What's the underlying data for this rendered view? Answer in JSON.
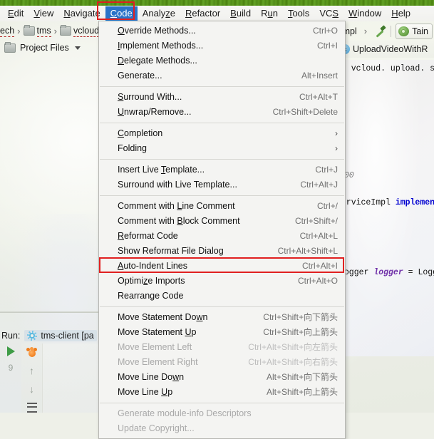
{
  "topbar": {
    "strip_color": "#4f8a18"
  },
  "menubar": {
    "items": [
      {
        "label": "Edit",
        "mnemonic": "E",
        "active": false
      },
      {
        "label": "View",
        "mnemonic": "V",
        "active": false
      },
      {
        "label": "Navigate",
        "mnemonic": "N",
        "active": false
      },
      {
        "label": "Code",
        "mnemonic": "C",
        "active": true
      },
      {
        "label": "Analyze",
        "mnemonic": "z",
        "active": false
      },
      {
        "label": "Refactor",
        "mnemonic": "R",
        "active": false
      },
      {
        "label": "Build",
        "mnemonic": "B",
        "active": false
      },
      {
        "label": "Run",
        "mnemonic": "u",
        "active": false
      },
      {
        "label": "Tools",
        "mnemonic": "T",
        "active": false
      },
      {
        "label": "VCS",
        "mnemonic": "S",
        "active": false
      },
      {
        "label": "Window",
        "mnemonic": "W",
        "active": false
      },
      {
        "label": "Help",
        "mnemonic": "H",
        "active": false
      }
    ]
  },
  "navbar": {
    "crumbs": [
      "ech",
      "tms",
      "vcloud",
      "ceImpl"
    ],
    "run_config": "Tain",
    "project_files_label": "Project Files"
  },
  "classbar": {
    "icon_letter": "c",
    "class_name": "UploadVideoWithR"
  },
  "editor_fragments": {
    "package_line": "s. vcloud. upload. servic",
    "time_line": ":00",
    "class_line_prefix": "ServiceImpl ",
    "class_line_keyword": "implement",
    "logger_prefix": "Logger ",
    "logger_field": "logger",
    "logger_suffix": " = Logge"
  },
  "run_toolwindow": {
    "label": "Run:",
    "tab_name": "tms-client [pa",
    "gutter_number": "9"
  },
  "code_menu": {
    "highlight_color": "#e02020",
    "groups": [
      {
        "items": [
          {
            "label": "Override Methods...",
            "mnemonic": "O",
            "accel": "Ctrl+O",
            "disabled": false,
            "submenu": false
          },
          {
            "label": "Implement Methods...",
            "mnemonic": "I",
            "accel": "Ctrl+I",
            "disabled": false,
            "submenu": false
          },
          {
            "label": "Delegate Methods...",
            "mnemonic": "D",
            "accel": "",
            "disabled": false,
            "submenu": false
          },
          {
            "label": "Generate...",
            "mnemonic": "",
            "accel": "Alt+Insert",
            "disabled": false,
            "submenu": false
          }
        ]
      },
      {
        "items": [
          {
            "label": "Surround With...",
            "mnemonic": "S",
            "accel": "Ctrl+Alt+T",
            "disabled": false,
            "submenu": false
          },
          {
            "label": "Unwrap/Remove...",
            "mnemonic": "U",
            "accel": "Ctrl+Shift+Delete",
            "disabled": false,
            "submenu": false
          }
        ]
      },
      {
        "items": [
          {
            "label": "Completion",
            "mnemonic": "C",
            "accel": "",
            "disabled": false,
            "submenu": true
          },
          {
            "label": "Folding",
            "mnemonic": "",
            "accel": "",
            "disabled": false,
            "submenu": true
          }
        ]
      },
      {
        "items": [
          {
            "label": "Insert Live Template...",
            "mnemonic": "T",
            "accel": "Ctrl+J",
            "disabled": false,
            "submenu": false
          },
          {
            "label": "Surround with Live Template...",
            "mnemonic": "",
            "accel": "Ctrl+Alt+J",
            "disabled": false,
            "submenu": false
          }
        ]
      },
      {
        "items": [
          {
            "label": "Comment with Line Comment",
            "mnemonic": "L",
            "accel": "Ctrl+/",
            "disabled": false,
            "submenu": false
          },
          {
            "label": "Comment with Block Comment",
            "mnemonic": "B",
            "accel": "Ctrl+Shift+/",
            "disabled": false,
            "submenu": false
          },
          {
            "label": "Reformat Code",
            "mnemonic": "R",
            "accel": "Ctrl+Alt+L",
            "disabled": false,
            "submenu": false
          },
          {
            "label": "Show Reformat File Dialog",
            "mnemonic": "",
            "accel": "Ctrl+Alt+Shift+L",
            "disabled": false,
            "submenu": false
          },
          {
            "label": "Auto-Indent Lines",
            "mnemonic": "A",
            "accel": "Ctrl+Alt+I",
            "disabled": false,
            "submenu": false
          },
          {
            "label": "Optimize Imports",
            "mnemonic": "z",
            "accel": "Ctrl+Alt+O",
            "disabled": false,
            "submenu": false,
            "highlighted": true
          },
          {
            "label": "Rearrange Code",
            "mnemonic": "",
            "accel": "",
            "disabled": false,
            "submenu": false
          }
        ]
      },
      {
        "items": [
          {
            "label": "Move Statement Down",
            "mnemonic": "w",
            "accel": "Ctrl+Shift+向下箭头",
            "disabled": false,
            "submenu": false
          },
          {
            "label": "Move Statement Up",
            "mnemonic": "U",
            "accel": "Ctrl+Shift+向上箭头",
            "disabled": false,
            "submenu": false
          },
          {
            "label": "Move Element Left",
            "mnemonic": "",
            "accel": "Ctrl+Alt+Shift+向左箭头",
            "disabled": true,
            "submenu": false
          },
          {
            "label": "Move Element Right",
            "mnemonic": "",
            "accel": "Ctrl+Alt+Shift+向右箭头",
            "disabled": true,
            "submenu": false
          },
          {
            "label": "Move Line Down",
            "mnemonic": "w",
            "accel": "Alt+Shift+向下箭头",
            "disabled": false,
            "submenu": false
          },
          {
            "label": "Move Line Up",
            "mnemonic": "U",
            "accel": "Alt+Shift+向上箭头",
            "disabled": false,
            "submenu": false
          }
        ]
      },
      {
        "items": [
          {
            "label": "Generate module-info Descriptors",
            "mnemonic": "",
            "accel": "",
            "disabled": true,
            "submenu": false
          },
          {
            "label": "Update Copyright...",
            "mnemonic": "",
            "accel": "",
            "disabled": true,
            "submenu": false
          }
        ]
      }
    ]
  }
}
